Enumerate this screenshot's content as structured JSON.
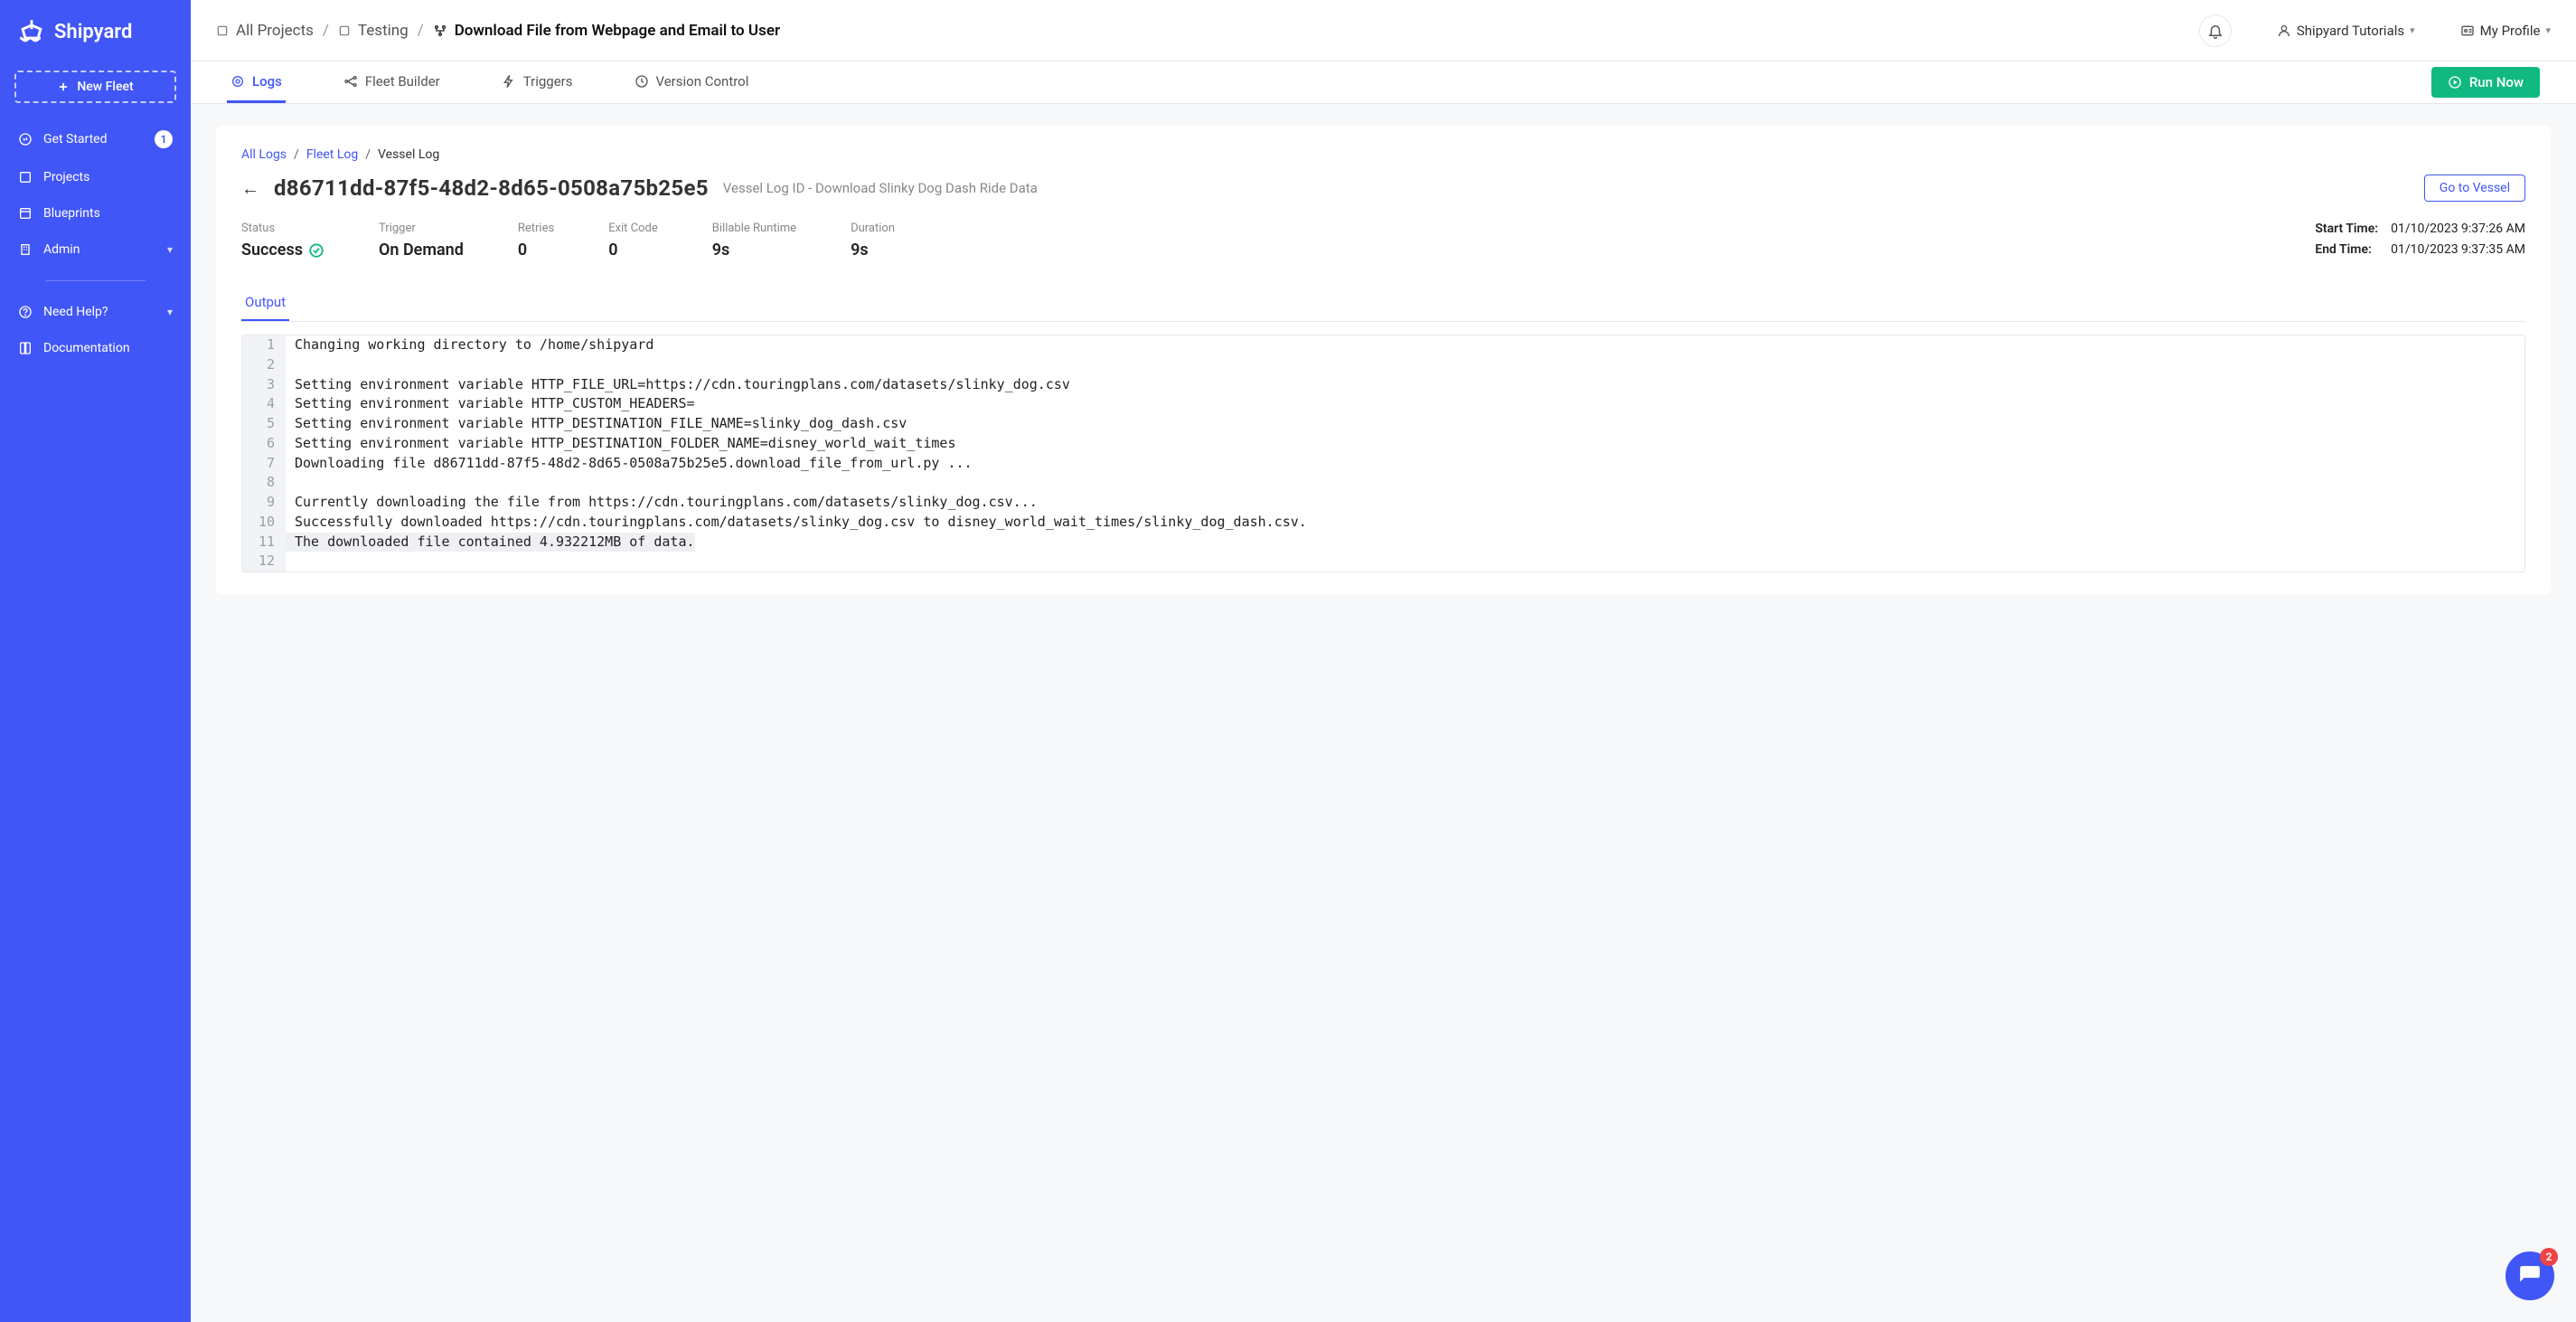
{
  "brand": "Shipyard",
  "sidebar": {
    "new_fleet": "New Fleet",
    "items": [
      {
        "label": "Get Started",
        "badge": "1"
      },
      {
        "label": "Projects"
      },
      {
        "label": "Blueprints"
      },
      {
        "label": "Admin",
        "chevron": true
      }
    ],
    "help": "Need Help?",
    "docs": "Documentation"
  },
  "topbar": {
    "crumbs": [
      {
        "label": "All Projects"
      },
      {
        "label": "Testing"
      },
      {
        "label": "Download File from Webpage and Email to User",
        "strong": true
      }
    ],
    "tutorials": "Shipyard Tutorials",
    "profile": "My Profile"
  },
  "tabs": {
    "logs": "Logs",
    "fleet_builder": "Fleet Builder",
    "triggers": "Triggers",
    "version_control": "Version Control",
    "run_now": "Run Now"
  },
  "page": {
    "crumbs": {
      "all_logs": "All Logs",
      "fleet_log": "Fleet Log",
      "vessel_log": "Vessel Log"
    },
    "vessel_id": "d86711dd-87f5-48d2-8d65-0508a75b25e5",
    "vessel_sub": "Vessel Log ID - Download Slinky Dog Dash Ride Data",
    "go_vessel": "Go to Vessel",
    "stats": {
      "status_label": "Status",
      "status_value": "Success",
      "trigger_label": "Trigger",
      "trigger_value": "On Demand",
      "retries_label": "Retries",
      "retries_value": "0",
      "exit_label": "Exit Code",
      "exit_value": "0",
      "runtime_label": "Billable Runtime",
      "runtime_value": "9s",
      "duration_label": "Duration",
      "duration_value": "9s",
      "start_label": "Start Time:",
      "start_value": "01/10/2023 9:37:26 AM",
      "end_label": "End Time:",
      "end_value": "01/10/2023 9:37:35 AM"
    },
    "output_tab": "Output",
    "log_lines": [
      "Changing working directory to /home/shipyard",
      "",
      "Setting environment variable HTTP_FILE_URL=https://cdn.touringplans.com/datasets/slinky_dog.csv",
      "Setting environment variable HTTP_CUSTOM_HEADERS=",
      "Setting environment variable HTTP_DESTINATION_FILE_NAME=slinky_dog_dash.csv",
      "Setting environment variable HTTP_DESTINATION_FOLDER_NAME=disney_world_wait_times",
      "Downloading file d86711dd-87f5-48d2-8d65-0508a75b25e5.download_file_from_url.py ...",
      "",
      "Currently downloading the file from https://cdn.touringplans.com/datasets/slinky_dog.csv...",
      "Successfully downloaded https://cdn.touringplans.com/datasets/slinky_dog.csv to disney_world_wait_times/slinky_dog_dash.csv.",
      "The downloaded file contained 4.932212MB of data.",
      ""
    ],
    "highlight_index": 10
  },
  "chat_notif": "2"
}
